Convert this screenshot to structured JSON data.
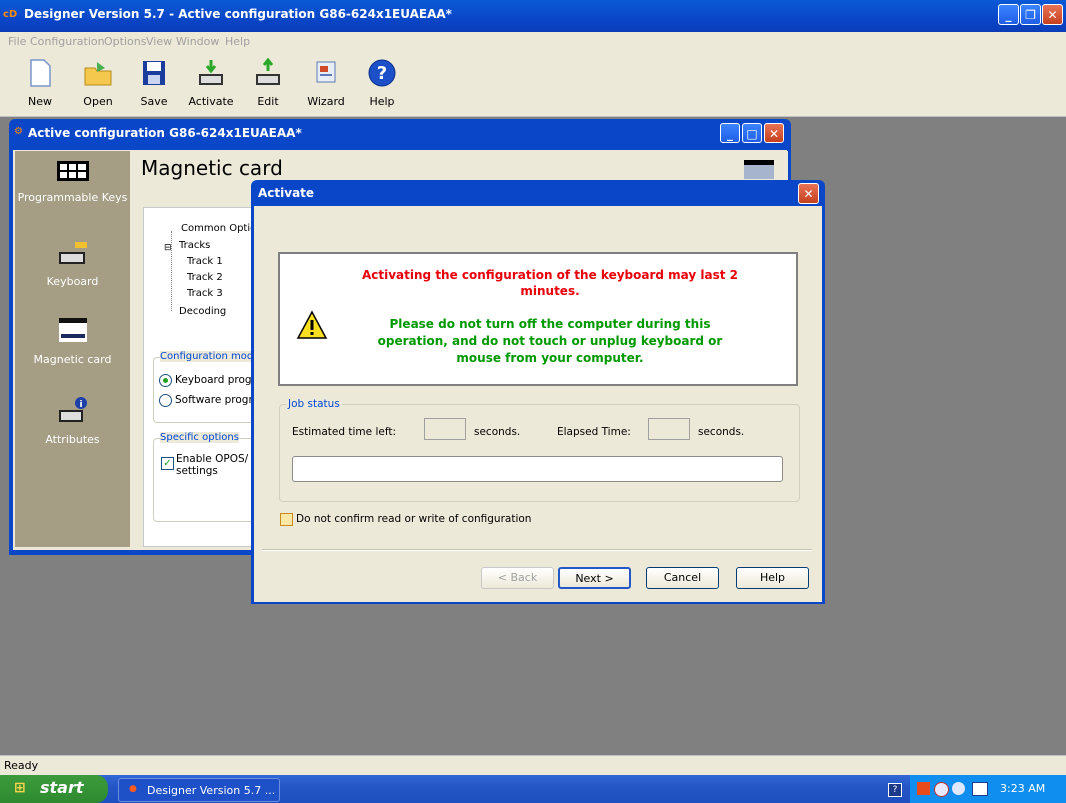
{
  "app": {
    "title": "Designer Version 5.7 - Active configuration G86-624x1EUAEAA*",
    "icon_label": "cD"
  },
  "menu": [
    "File",
    "Configuration",
    "Options",
    "View",
    "Window",
    "Help"
  ],
  "toolbar": [
    {
      "label": "New",
      "icon": "new-document-icon"
    },
    {
      "label": "Open",
      "icon": "open-folder-icon"
    },
    {
      "label": "Save",
      "icon": "save-disk-icon"
    },
    {
      "label": "Activate",
      "icon": "activate-keyboard-icon"
    },
    {
      "label": "Edit",
      "icon": "edit-keyboard-icon"
    },
    {
      "label": "Wizard",
      "icon": "wizard-icon"
    },
    {
      "label": "Help",
      "icon": "help-icon"
    }
  ],
  "child_window": {
    "title": "Active configuration G86-624x1EUAEAA*",
    "nav": [
      {
        "label": "Programmable Keys",
        "icon": "programmable-keys-icon"
      },
      {
        "label": "Keyboard",
        "icon": "keyboard-icon"
      },
      {
        "label": "Magnetic card",
        "icon": "magnetic-card-icon"
      },
      {
        "label": "Attributes",
        "icon": "attributes-icon"
      }
    ],
    "section_title": "Magnetic card",
    "tree": [
      "Common Optic",
      "Tracks",
      "Track 1",
      "Track 2",
      "Track 3",
      "Decoding"
    ],
    "config_mode": {
      "label": "Configuration mod",
      "options": [
        {
          "label": "Keyboard progr",
          "selected": true
        },
        {
          "label": "Software progra",
          "selected": false
        }
      ]
    },
    "specific_options": {
      "label": "Specific options",
      "checkbox_line1": "Enable OPOS/",
      "checkbox_line2": "settings",
      "checked": true
    }
  },
  "dialog": {
    "title": "Activate",
    "warning_line1": "Activating the configuration of the keyboard may last 2",
    "warning_line2": "minutes.",
    "info_line1": "Please do not turn off the computer during this",
    "info_line2": "operation, and do not touch or unplug keyboard or",
    "info_line3": "mouse from your computer.",
    "job_status": {
      "label": "Job status",
      "estimated_label": "Estimated time left:",
      "estimated_value": "",
      "seconds1": "seconds.",
      "elapsed_label": "Elapsed Time:",
      "elapsed_value": "",
      "seconds2": "seconds.",
      "progress": 0
    },
    "confirm_checkbox": {
      "label": "Do not confirm read or write of configuration",
      "checked": false
    },
    "buttons": {
      "back": "< Back",
      "next": "Next >",
      "cancel": "Cancel",
      "help": "Help"
    }
  },
  "status": "Ready",
  "taskbar": {
    "start": "start",
    "task_button": "Designer Version 5.7 ...",
    "clock": "3:23 AM"
  },
  "colors": {
    "warning": "#e8000a",
    "info": "#009900",
    "titlebar": "#0a46c8",
    "nav_bg": "#a59e85"
  }
}
